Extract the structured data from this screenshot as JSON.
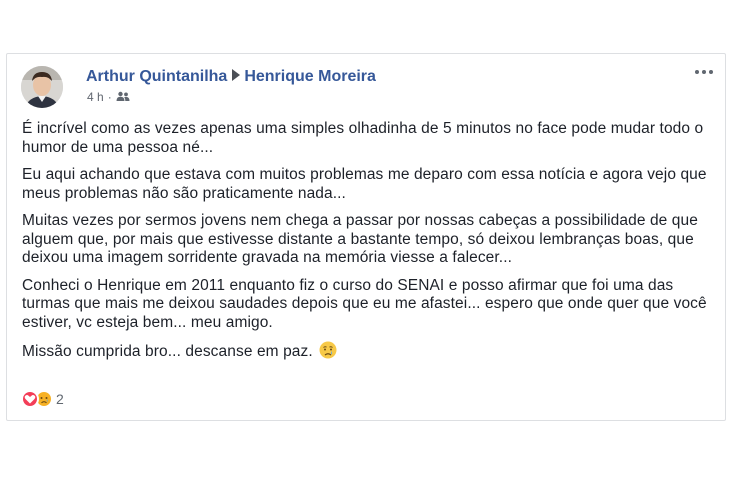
{
  "post": {
    "author": "Arthur Quintanilha",
    "recipient": "Henrique Moreira",
    "time": "4 h",
    "separator": "·",
    "privacy_icon": "friends-icon",
    "paragraphs": [
      "É incrível como as vezes apenas uma simples olhadinha de 5 minutos no face pode mudar todo o humor de uma pessoa né...",
      "Eu aqui achando que estava com muitos problemas me deparo com essa notícia e agora vejo que meus problemas não são praticamente nada...",
      "Muitas vezes por sermos jovens nem chega a passar por nossas cabeças a possibilidade de que alguem que, por mais que estivesse distante a bastante tempo, só deixou lembranças boas, que deixou uma imagem sorridente gravada na memória viesse a falecer...",
      "Conheci o Henrique em 2011 enquanto fiz o curso do SENAI e posso afirmar que foi uma das turmas que mais me deixou saudades depois que eu me afastei... espero que onde quer que você estiver, vc esteja bem... meu amigo."
    ],
    "last_line": "Missão cumprida bro... descanse em paz.",
    "reaction_count": "2",
    "colors": {
      "link": "#365899",
      "text": "#1d2129",
      "meta": "#616770",
      "love": "#f33e58",
      "sad": "#f7b125"
    }
  }
}
